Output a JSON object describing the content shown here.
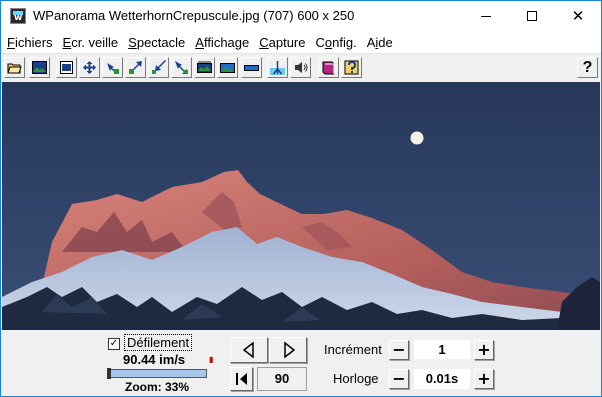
{
  "window": {
    "title": "WPanorama  WetterhornCrepuscule.jpg  (707) 600 x 250"
  },
  "menu": [
    {
      "label": "Fichiers",
      "mnemonic": "F"
    },
    {
      "label": "Ecr. veille",
      "mnemonic": "E"
    },
    {
      "label": "Spectacle",
      "mnemonic": "S"
    },
    {
      "label": "Affichage",
      "mnemonic": "A"
    },
    {
      "label": "Capture",
      "mnemonic": "C"
    },
    {
      "label": "Config.",
      "mnemonic": "o"
    },
    {
      "label": "Aide",
      "mnemonic": "i"
    }
  ],
  "toolbar": {
    "buttons": [
      "open-folder-icon",
      "landscape-image-icon",
      "fit-window-icon",
      "expand-arrows-icon",
      "shrink-left-icon",
      "expand-diagonal-icon",
      "shrink-diagonal-icon",
      "shrink-corner-icon",
      "panorama-band-icon",
      "panorama-wide-icon",
      "panorama-strip-icon",
      "tripod-icon",
      "speaker-icon",
      "book-icon",
      "help-book-icon"
    ],
    "help_label": "?"
  },
  "controls": {
    "scroll_checkbox_checked": true,
    "scroll_label": "Défilement",
    "speed_value": "90.44 im/s",
    "zoom_text": "Zoom: 33%",
    "zoom_slider_level": 0.0,
    "frame_value": "90",
    "increment_label": "Incrément",
    "increment_value": "1",
    "clock_label": "Horloge",
    "clock_value": "0.01s",
    "minus_label": "−",
    "plus_label": "+",
    "check_mark": "✓"
  },
  "colors": {
    "sky": "#2c3f63",
    "peak_glow": "#c9746e",
    "accent": "#1883d7"
  }
}
